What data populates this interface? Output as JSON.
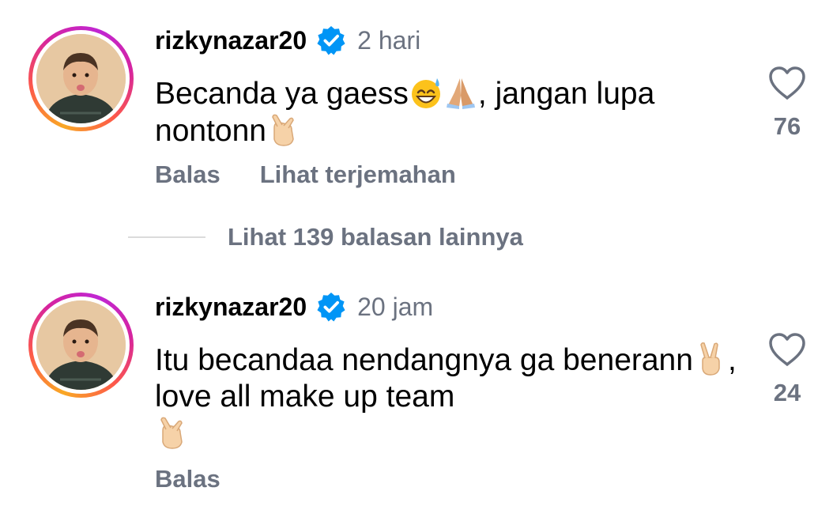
{
  "comments": [
    {
      "username": "rizkynazar20",
      "verified": true,
      "time": "2 hari",
      "text_part1": "Becanda ya gaess",
      "emoji_1": "grinning-sweat-emoji",
      "emoji_2": "folded-hands-emoji",
      "text_part2": ", jangan lupa nontonn",
      "emoji_3": "finger-heart-emoji",
      "reply_label": "Balas",
      "translate_label": "Lihat terjemahan",
      "likes": "76"
    },
    {
      "username": "rizkynazar20",
      "verified": true,
      "time": "20 jam",
      "text_part1": "Itu becandaa nendangnya ga benerann",
      "emoji_1": "victory-hand-emoji",
      "text_part2": ", love all make up team",
      "emoji_2": "finger-heart-emoji",
      "reply_label": "Balas",
      "likes": "24"
    }
  ],
  "more_replies": {
    "label": "Lihat 139 balasan lainnya"
  },
  "colors": {
    "verified_blue": "#0095f6",
    "secondary_text": "#6b7280",
    "divider": "#dbdbdb"
  }
}
